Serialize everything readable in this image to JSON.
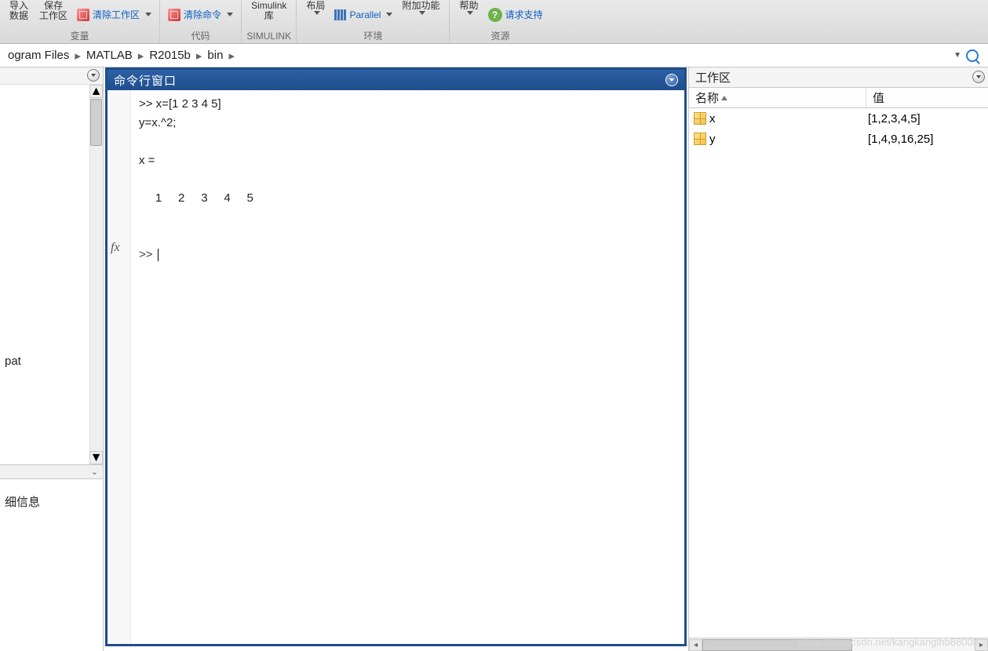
{
  "ribbon": {
    "groups": [
      {
        "label": "变量",
        "items": [
          {
            "name": "import-data",
            "line1": "导入",
            "line2": "数据"
          },
          {
            "name": "save-workspace",
            "line1": "保存",
            "line2": "工作区"
          },
          {
            "name": "clear-workspace",
            "label": "清除工作区"
          }
        ]
      },
      {
        "label": "代码",
        "items": [
          {
            "name": "clear-commands",
            "label": "清除命令"
          }
        ]
      },
      {
        "label": "SIMULINK",
        "items": [
          {
            "name": "simulink-lib",
            "line1": "Simulink",
            "line2": "库"
          }
        ]
      },
      {
        "label": "环境",
        "items": [
          {
            "name": "layout",
            "line1": "布局",
            "line2": ""
          },
          {
            "name": "parallel",
            "label": "Parallel"
          },
          {
            "name": "addons",
            "line1": "附加功能",
            "line2": ""
          }
        ]
      },
      {
        "label": "资源",
        "items": [
          {
            "name": "help",
            "line1": "帮助",
            "line2": ""
          },
          {
            "name": "request-support",
            "label": "请求支持"
          }
        ]
      }
    ]
  },
  "breadcrumb": {
    "parts": [
      "ogram Files",
      "MATLAB",
      "R2015b",
      "bin"
    ]
  },
  "left": {
    "file": "pat",
    "details_label": "细信息"
  },
  "command_window": {
    "title": "命令行窗口",
    "lines": [
      ">> x=[1 2 3 4 5]",
      "y=x.^2;",
      "",
      "x =",
      "",
      "     1     2     3     4     5",
      "",
      ""
    ],
    "prompt": ">> ",
    "fx": "fx"
  },
  "workspace": {
    "title": "工作区",
    "col_name": "名称",
    "col_value": "值",
    "vars": [
      {
        "name": "x",
        "value": "[1,2,3,4,5]"
      },
      {
        "name": "y",
        "value": "[1,4,9,16,25]"
      }
    ]
  },
  "watermark": "https://blog.csdn.net/kangkanglhb88008"
}
